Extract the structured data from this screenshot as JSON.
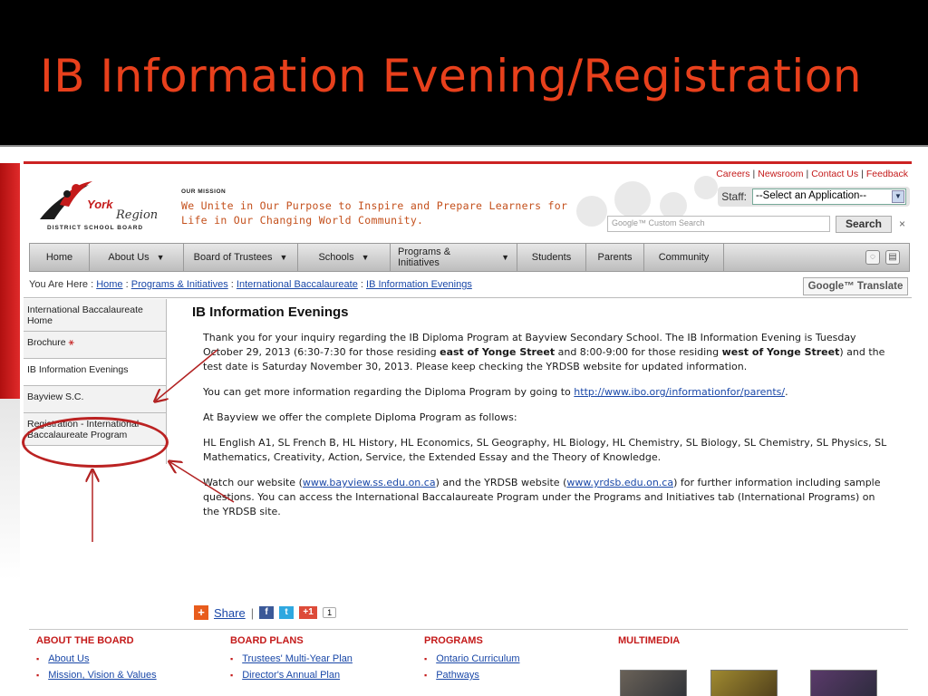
{
  "slide": {
    "title": "IB Information Evening/Registration"
  },
  "site": {
    "logo": {
      "name": "York",
      "region": "Region",
      "board": "DISTRICT SCHOOL BOARD"
    },
    "mission": {
      "label": "OUR MISSION",
      "line1": "We Unite in Our Purpose to Inspire and Prepare Learners for",
      "line2": "Life in Our Changing World Community."
    },
    "toplinks": [
      "Careers",
      "Newsroom",
      "Contact Us",
      "Feedback"
    ],
    "staff": {
      "label": "Staff:",
      "selected": "--Select an Application--"
    },
    "search": {
      "placeholder": "Google™ Custom Search",
      "button": "Search",
      "close": "×"
    },
    "nav": [
      {
        "label": "Home",
        "dropdown": false
      },
      {
        "label": "About Us",
        "dropdown": true
      },
      {
        "label": "Board of Trustees",
        "dropdown": true
      },
      {
        "label": "Schools",
        "dropdown": true
      },
      {
        "label": "Programs & Initiatives",
        "dropdown": true
      },
      {
        "label": "Students",
        "dropdown": false
      },
      {
        "label": "Parents",
        "dropdown": false
      },
      {
        "label": "Community",
        "dropdown": false
      }
    ],
    "breadcrumb": {
      "prefix": "You Are Here :",
      "items": [
        "Home",
        "Programs & Initiatives",
        "International Baccalaureate",
        "IB Information Evenings"
      ],
      "sep": ":"
    },
    "translate": "Google™ Translate",
    "sidenav": [
      "International Baccalaureate Home",
      "Brochure",
      "IB Information Evenings",
      "Bayview S.C.",
      "Registration - International Baccalaureate Program"
    ],
    "content": {
      "heading": "IB Information Evenings",
      "p1_a": "Thank you for your inquiry regarding the IB Diploma Program at Bayview Secondary School. The IB Information Evening is Tuesday October 29, 2013 (6:30-7:30 for those residing ",
      "p1_b": "east of Yonge Street",
      "p1_c": " and 8:00-9:00 for those residing ",
      "p1_d": "west of Yonge Street",
      "p1_e": ") and the test date is Saturday November 30, 2013. Please keep checking the YRDSB website for updated information.",
      "p2_a": "You can get more information regarding the Diploma Program by going to ",
      "p2_link": "http://www.ibo.org/informationfor/parents/",
      "p2_b": ".",
      "p3": "At Bayview we offer the complete Diploma Program as follows:",
      "p4": "HL English A1, SL French B, HL History, HL Economics, SL Geography, HL Biology, HL Chemistry, SL Biology, SL Chemistry, SL Physics, SL Mathematics, Creativity, Action, Service, the Extended Essay and the Theory of Knowledge.",
      "p5_a": "Watch our website (",
      "p5_link1": "www.bayview.ss.edu.on.ca",
      "p5_b": ") and the YRDSB website (",
      "p5_link2": "www.yrdsb.edu.on.ca",
      "p5_c": ") for further information including sample questions. You can access the International Baccalaureate Program under the Programs and Initiatives tab (International Programs) on the YRDSB site."
    },
    "share": {
      "label": "Share",
      "sep": "|",
      "gplus": "+1",
      "count": "1"
    },
    "footer": [
      {
        "heading": "ABOUT THE BOARD",
        "links": [
          "About Us",
          "Mission, Vision & Values"
        ]
      },
      {
        "heading": "BOARD PLANS",
        "links": [
          "Trustees' Multi-Year Plan",
          "Director's Annual Plan"
        ]
      },
      {
        "heading": "PROGRAMS",
        "links": [
          "Ontario Curriculum",
          "Pathways"
        ]
      },
      {
        "heading": "MULTIMEDIA",
        "links": []
      }
    ]
  },
  "colors": {
    "title": "#e8401c",
    "brand_red": "#c41a1a",
    "annotation": "#b22222",
    "link": "#1a48a8"
  }
}
